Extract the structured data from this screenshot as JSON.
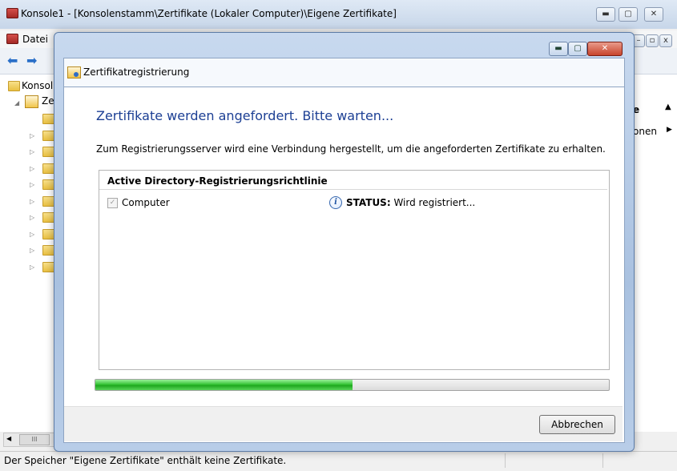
{
  "background_window": {
    "title": "Konsole1 - [Konsolenstamm\\Zertifikate (Lokaler Computer)\\Eigene Zertifikate]",
    "menu_first": "Datei",
    "tree_root": "Konsol",
    "tree_child": "Ze",
    "actions_header_partial": "e",
    "actions_item_partial": "onen",
    "status_bar": "Der Speicher \"Eigene Zertifikate\" enthält keine Zertifikate.",
    "hscroll_thumb": "III"
  },
  "dialog": {
    "title": "Zertifikatregistrierung",
    "heading": "Zertifikate werden angefordert. Bitte warten...",
    "description": "Zum Registrierungsserver wird eine Verbindung hergestellt, um die angeforderten Zertifikate zu erhalten.",
    "list": {
      "header": "Active Directory-Registrierungsrichtlinie",
      "items": [
        {
          "label": "Computer",
          "checked": true,
          "status_label": "STATUS:",
          "status_value": "Wird registriert..."
        }
      ]
    },
    "progress": {
      "value_percent": 50
    },
    "cancel_label": "Abbrechen"
  },
  "colors": {
    "heading": "#1c3f94",
    "progress_fill": "#37c437"
  }
}
